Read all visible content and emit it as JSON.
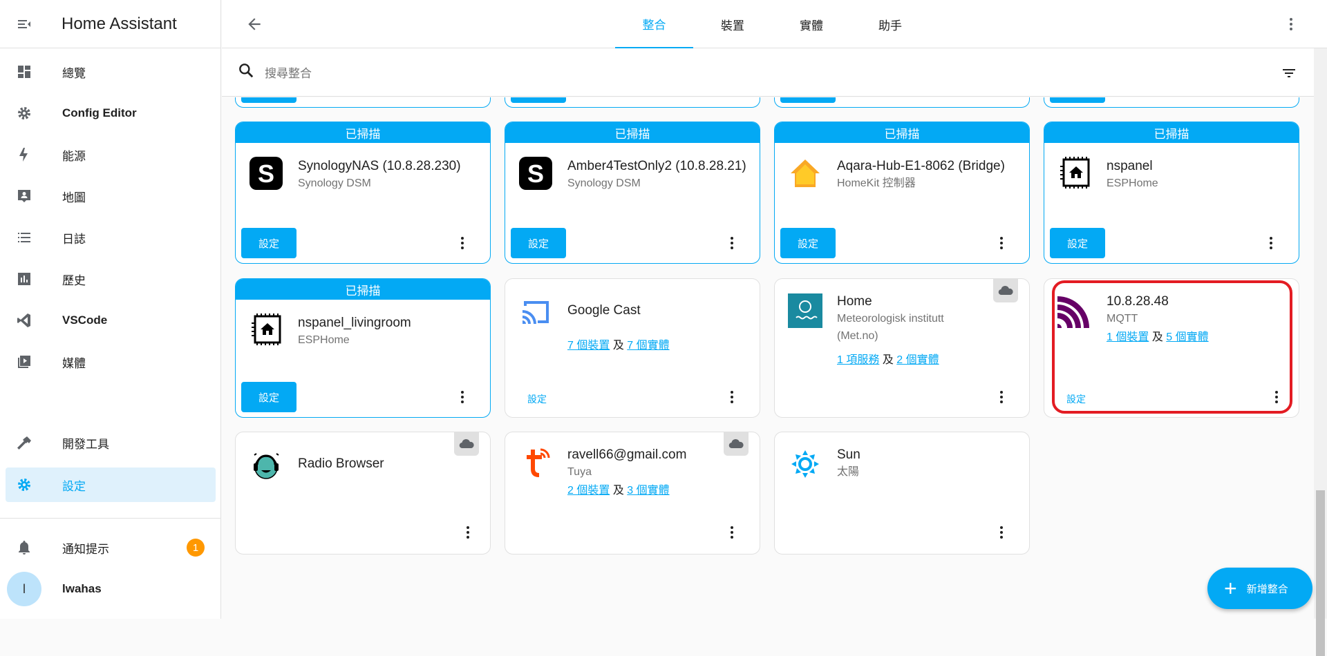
{
  "app": {
    "title": "Home Assistant"
  },
  "sidebar": {
    "items": [
      {
        "label": "總覽",
        "icon": "dashboard-icon"
      },
      {
        "label": "Config Editor",
        "icon": "gear-icon"
      },
      {
        "label": "能源",
        "icon": "lightning-icon"
      },
      {
        "label": "地圖",
        "icon": "map-person-icon"
      },
      {
        "label": "日誌",
        "icon": "list-icon"
      },
      {
        "label": "歷史",
        "icon": "chart-icon"
      },
      {
        "label": "VSCode",
        "icon": "vscode-icon"
      },
      {
        "label": "媒體",
        "icon": "media-icon"
      }
    ],
    "devtools": "開發工具",
    "settings": "設定",
    "notifications": {
      "label": "通知提示",
      "count": "1"
    },
    "user": {
      "name": "lwahas",
      "initial": "l"
    }
  },
  "tabs": [
    "整合",
    "裝置",
    "實體",
    "助手"
  ],
  "search": {
    "placeholder": "搜尋整合"
  },
  "discovered_label": "已掃描",
  "configure_label": "設定",
  "and_label": "及",
  "cards": {
    "synology1": {
      "title": "SynologyNAS (10.8.28.230)",
      "subtitle": "Synology DSM"
    },
    "synology2": {
      "title": "Amber4TestOnly2 (10.8.28.21)",
      "subtitle": "Synology DSM"
    },
    "aqara": {
      "title": "Aqara-Hub-E1-8062 (Bridge)",
      "subtitle": "HomeKit 控制器"
    },
    "nspanel": {
      "title": "nspanel",
      "subtitle": "ESPHome"
    },
    "nspanel_living": {
      "title": "nspanel_livingroom",
      "subtitle": "ESPHome"
    },
    "cast": {
      "title": "Google Cast",
      "link1": "7 個裝置",
      "link2": "7 個實體"
    },
    "met": {
      "title": "Home",
      "subtitle": "Meteorologisk institutt (Met.no)",
      "link1": "1 項服務",
      "link2": "2 個實體"
    },
    "mqtt": {
      "title": "10.8.28.48",
      "subtitle": "MQTT",
      "link1": "1 個裝置",
      "link2": "5 個實體"
    },
    "radio": {
      "title": "Radio Browser"
    },
    "tuya": {
      "title": "ravell66@gmail.com",
      "subtitle": "Tuya",
      "link1": "2 個裝置",
      "link2": "3 個實體"
    },
    "sun": {
      "title": "Sun",
      "subtitle": "太陽"
    }
  },
  "fab": {
    "label": "新增整合"
  },
  "colors": {
    "primary": "#03a9f4",
    "highlight": "#e31c23",
    "badge": "#ff9800"
  }
}
